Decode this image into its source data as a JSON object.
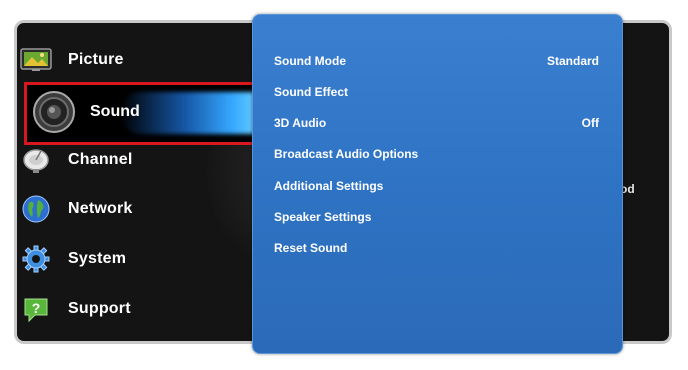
{
  "main_menu": {
    "items": [
      {
        "label": "Picture",
        "icon": "picture-icon"
      },
      {
        "label": "Sound",
        "icon": "speaker-icon"
      },
      {
        "label": "Channel",
        "icon": "satellite-dish-icon"
      },
      {
        "label": "Network",
        "icon": "globe-icon"
      },
      {
        "label": "System",
        "icon": "gear-icon"
      },
      {
        "label": "Support",
        "icon": "help-icon"
      }
    ],
    "selected": "Sound"
  },
  "background_fragment": "od",
  "sound_submenu": {
    "items": [
      {
        "label": "Sound Mode",
        "value": "Standard"
      },
      {
        "label": "Sound Effect",
        "value": ""
      },
      {
        "label": "3D Audio",
        "value": "Off"
      },
      {
        "label": "Broadcast Audio Options",
        "value": ""
      },
      {
        "label": "Additional Settings",
        "value": ""
      },
      {
        "label": "Speaker Settings",
        "value": ""
      },
      {
        "label": "Reset Sound",
        "value": ""
      }
    ]
  },
  "colors": {
    "submenu_bg": "#2f73c4",
    "highlight_border": "#d8171e",
    "frame_bg": "#141414"
  }
}
